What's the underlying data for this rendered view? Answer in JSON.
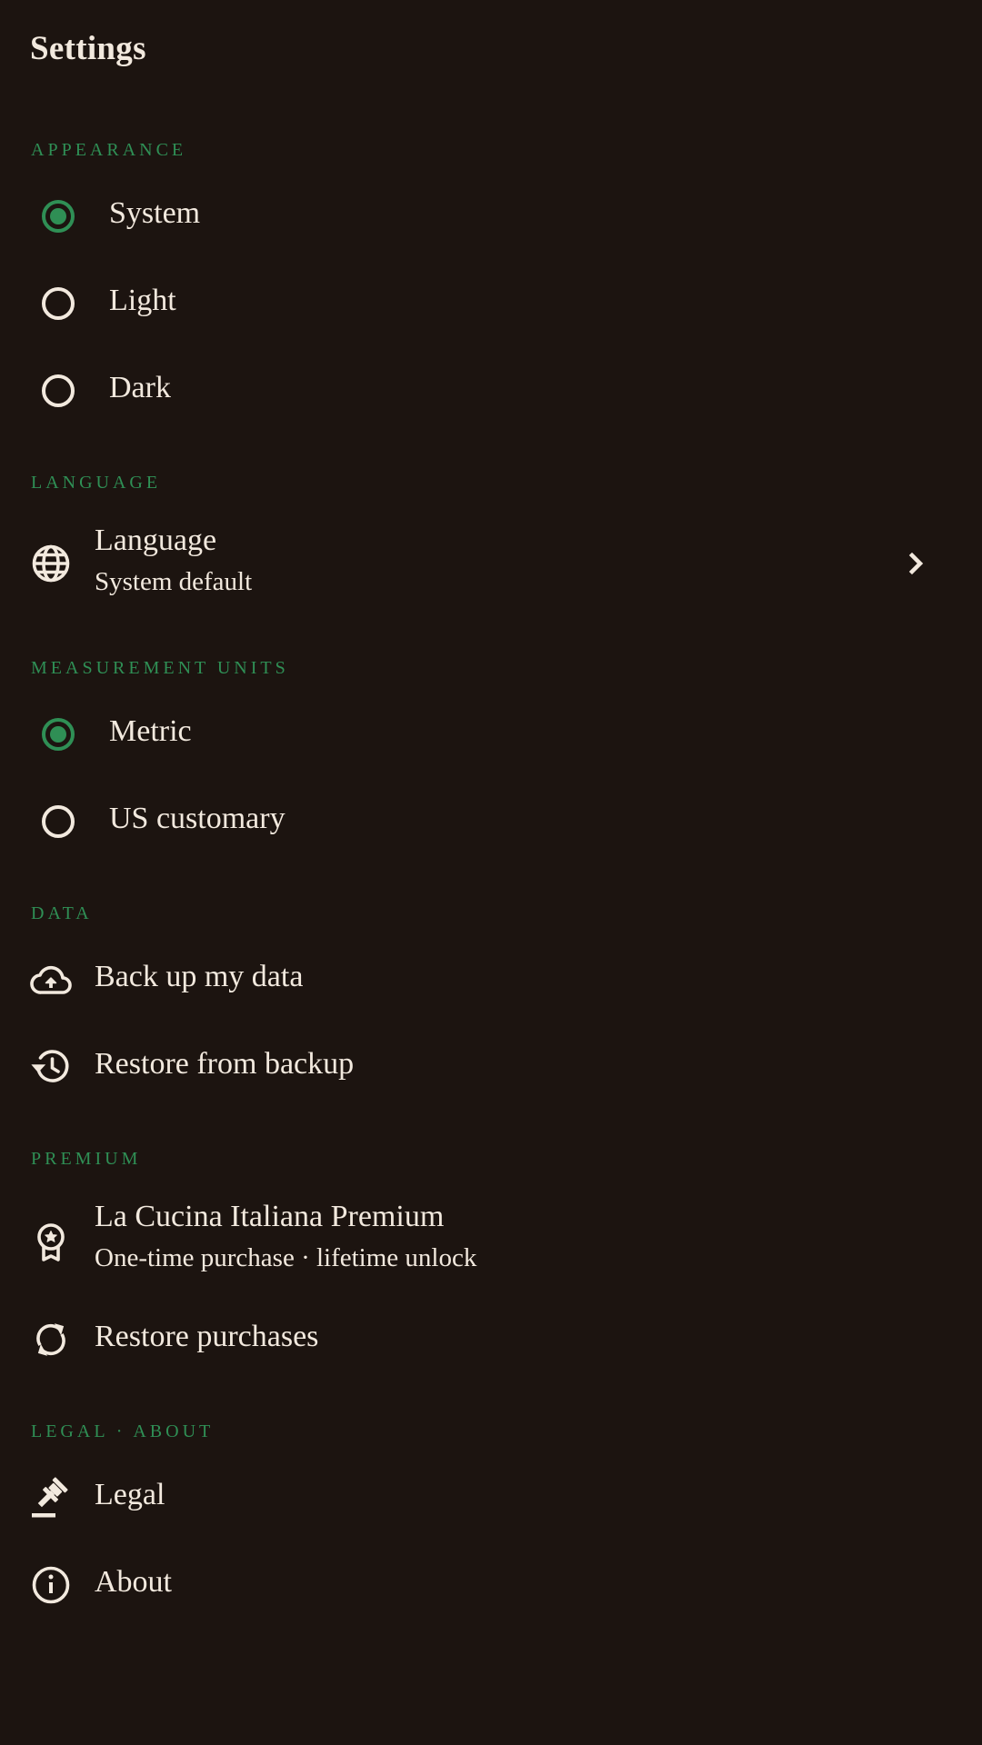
{
  "header": {
    "title": "Settings"
  },
  "appearance": {
    "header": "APPEARANCE",
    "options": [
      {
        "label": "System",
        "selected": true
      },
      {
        "label": "Light",
        "selected": false
      },
      {
        "label": "Dark",
        "selected": false
      }
    ]
  },
  "language": {
    "header": "LANGUAGE",
    "item": {
      "label": "Language",
      "value": "System default",
      "icon": "globe-icon"
    }
  },
  "units": {
    "header": "MEASUREMENT UNITS",
    "options": [
      {
        "label": "Metric",
        "selected": true
      },
      {
        "label": "US customary",
        "selected": false
      }
    ]
  },
  "data_section": {
    "header": "DATA",
    "items": [
      {
        "label": "Back up my data",
        "icon": "cloud-upload-icon"
      },
      {
        "label": "Restore from backup",
        "icon": "history-icon"
      }
    ]
  },
  "premium": {
    "header": "PREMIUM",
    "item": {
      "label": "La Cucina Italiana Premium",
      "subtitle": "One-time purchase · lifetime unlock",
      "icon": "award-icon"
    },
    "restore": {
      "label": "Restore purchases",
      "icon": "sync-icon"
    }
  },
  "legal_about": {
    "header": "LEGAL · ABOUT",
    "items": [
      {
        "label": "Legal",
        "icon": "gavel-icon"
      },
      {
        "label": "About",
        "icon": "info-icon"
      }
    ]
  },
  "colors": {
    "background": "#1c1410",
    "accent": "#2f8f55",
    "text": "#f2e9de"
  }
}
